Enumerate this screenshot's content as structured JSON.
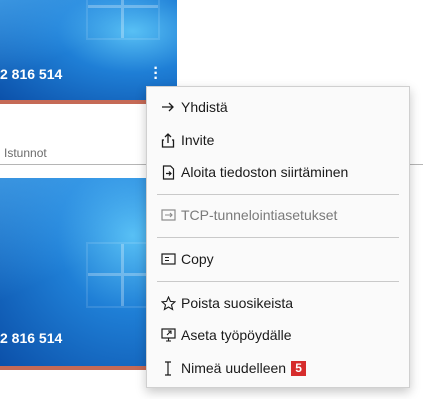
{
  "cards": [
    {
      "number": "2 816 514"
    },
    {
      "number": "2 816 514"
    }
  ],
  "section_label": "Istunnot",
  "context_menu": {
    "items": [
      {
        "label": "Yhdistä",
        "icon": "arrow-right-icon"
      },
      {
        "label": "Invite",
        "icon": "share-icon"
      },
      {
        "label": "Aloita tiedoston siirtäminen",
        "icon": "file-transfer-icon"
      },
      {
        "label": "TCP-tunnelointiasetukset",
        "icon": "tunnel-icon",
        "disabled": true
      },
      {
        "label": "Copy",
        "icon": "copy-icon"
      },
      {
        "label": "Poista suosikeista",
        "icon": "star-icon"
      },
      {
        "label": "Aseta työpöydälle",
        "icon": "desktop-shortcut-icon"
      },
      {
        "label": "Nimeä uudelleen",
        "icon": "text-cursor-icon",
        "badge": "5"
      }
    ]
  },
  "colors": {
    "accent_strip": "#c56a56",
    "badge": "#d62c2c"
  }
}
